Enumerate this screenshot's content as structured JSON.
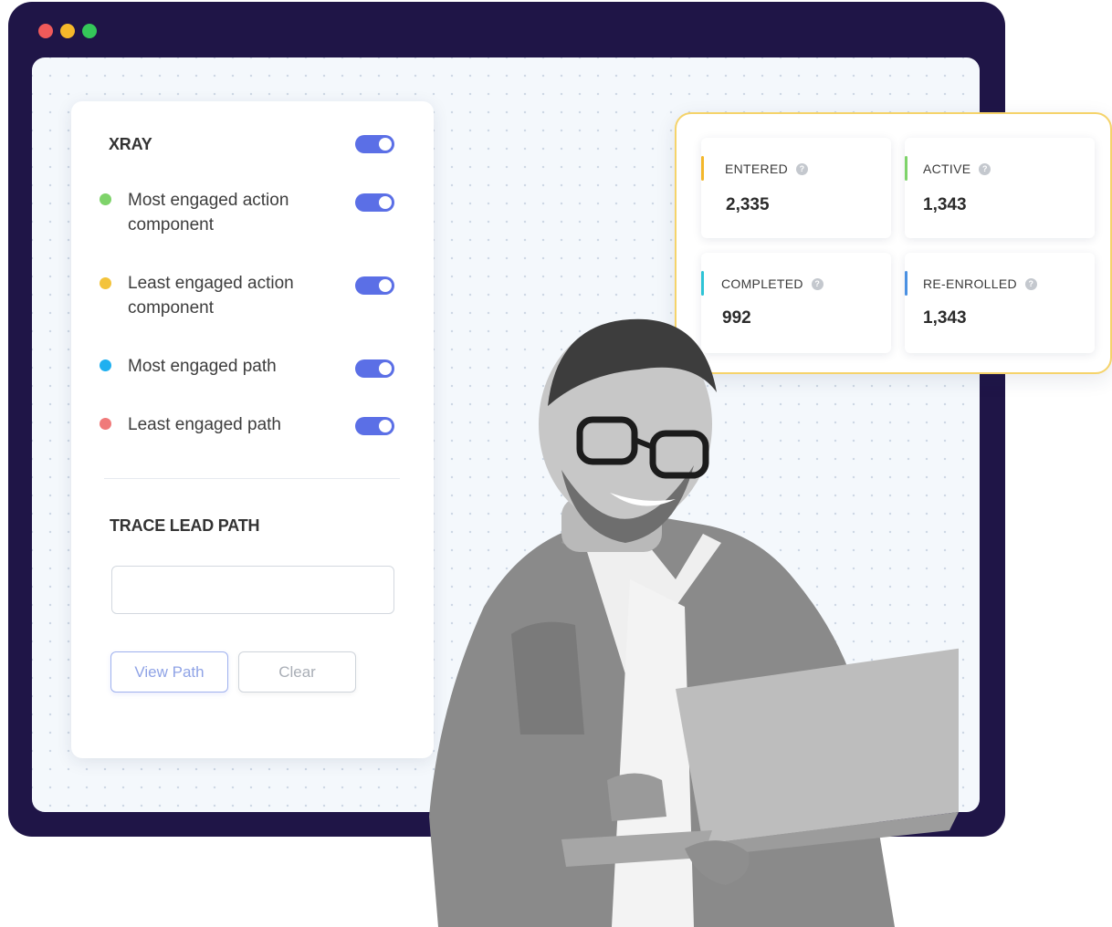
{
  "colors": {
    "window_frame": "#1f1547",
    "accent_toggle": "#5b6fe6",
    "stats_border": "#f5d36a"
  },
  "xray": {
    "title": "XRAY",
    "enabled": true,
    "items": [
      {
        "label": "Most engaged action component",
        "dot_color": "#7ed36a",
        "enabled": true
      },
      {
        "label": "Least engaged action component",
        "dot_color": "#f3c33a",
        "enabled": true
      },
      {
        "label": "Most engaged path",
        "dot_color": "#1fb0f0",
        "enabled": true
      },
      {
        "label": "Least engaged path",
        "dot_color": "#f07a7a",
        "enabled": true
      }
    ]
  },
  "trace": {
    "title": "TRACE LEAD PATH",
    "input_value": "",
    "view_path_label": "View Path",
    "clear_label": "Clear"
  },
  "stats": [
    {
      "label": "ENTERED",
      "value": "2,335",
      "color": "#f3b72b"
    },
    {
      "label": "ACTIVE",
      "value": "1,343",
      "color": "#7ed36a"
    },
    {
      "label": "COMPLETED",
      "value": "992",
      "color": "#2ec4d6"
    },
    {
      "label": "RE-ENROLLED",
      "value": "1,343",
      "color": "#4a90e2"
    }
  ],
  "icons": {
    "info": "question-circle-icon",
    "window_controls": [
      "close-dot",
      "minimize-dot",
      "maximize-dot"
    ]
  }
}
